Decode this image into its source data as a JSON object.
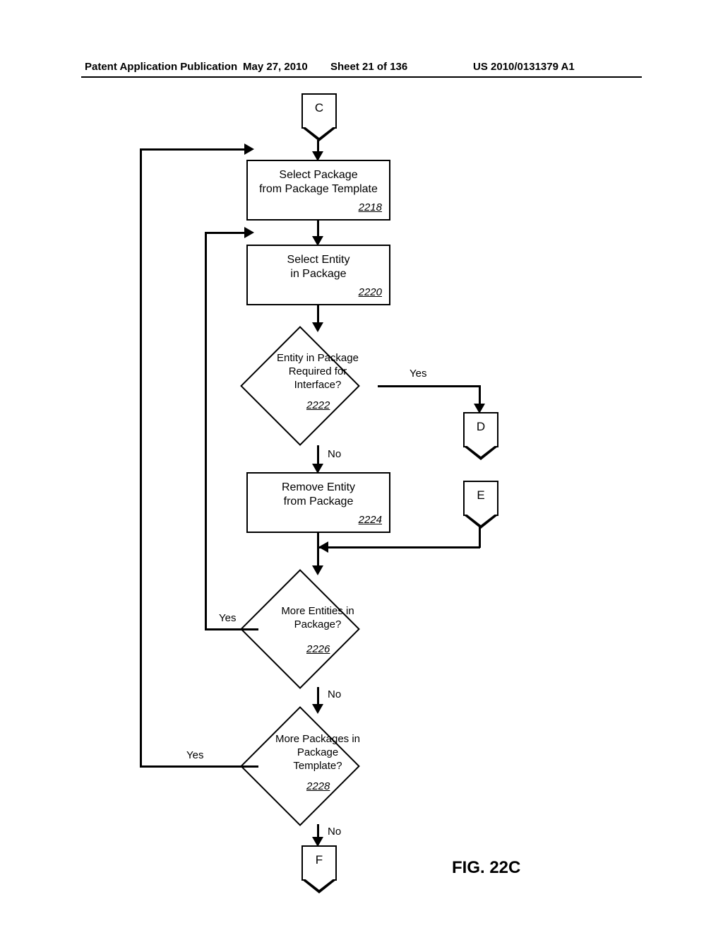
{
  "header": {
    "left": "Patent Application Publication",
    "date": "May 27, 2010",
    "sheet": "Sheet 21 of 136",
    "pubno": "US 2010/0131379 A1"
  },
  "connectors": {
    "c": "C",
    "d": "D",
    "e": "E",
    "f": "F"
  },
  "nodes": {
    "n2218": {
      "line1": "Select Package",
      "line2": "from Package Template",
      "ref": "2218"
    },
    "n2220": {
      "line1": "Select Entity",
      "line2": "in Package",
      "ref": "2220"
    },
    "n2222": {
      "line1": "Entity in Package",
      "line2": "Required for",
      "line3": "Interface?",
      "ref": "2222"
    },
    "n2224": {
      "line1": "Remove Entity",
      "line2": "from Package",
      "ref": "2224"
    },
    "n2226": {
      "line1": "More Entities in",
      "line2": "Package?",
      "ref": "2226"
    },
    "n2228": {
      "line1": "More Packages in",
      "line2": "Package",
      "line3": "Template?",
      "ref": "2228"
    }
  },
  "labels": {
    "yes": "Yes",
    "no": "No"
  },
  "figure": "FIG. 22C"
}
